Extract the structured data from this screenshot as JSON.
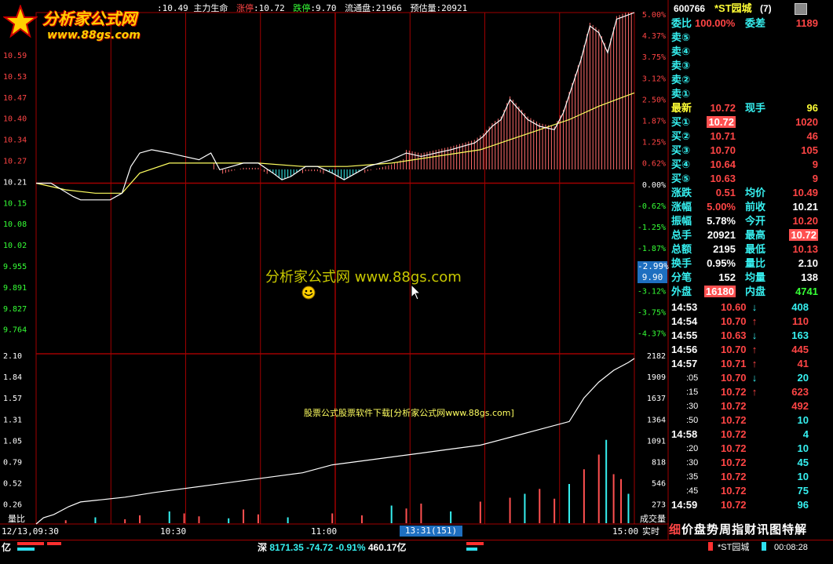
{
  "logo": {
    "title": "分析家公式网",
    "url": "www.88gs.com"
  },
  "info_bar": {
    "stock_name_partial": "*ST园城",
    "price_label": "均价",
    "price_value": ":10.49",
    "indicator": "主力生命",
    "limit_up_label": "涨停",
    "limit_up_value": ":10.72",
    "limit_down_label": "跌停",
    "limit_down_value": ":9.70",
    "float_label": "流通盘",
    "float_value": ":21966",
    "estimate_label": "预估量",
    "estimate_value": ":20921"
  },
  "watermark": {
    "main": "分析家公式网 www.88gs.com",
    "sub": "股票公式股票软件下载[分析家公式网www.88gs.com]"
  },
  "chart_data": {
    "type": "line",
    "price_axis": {
      "left_ticks": [
        "10.59",
        "10.53",
        "10.47",
        "10.40",
        "10.34",
        "10.27",
        "10.21",
        "10.15",
        "10.08",
        "10.02",
        "9.955",
        "9.891",
        "9.827",
        "9.764"
      ],
      "right_ticks": [
        "5.00%",
        "4.37%",
        "3.75%",
        "3.12%",
        "2.50%",
        "1.87%",
        "1.25%",
        "0.62%",
        "0.00%",
        "-0.62%",
        "-1.25%",
        "-1.87%",
        "-2.99%",
        "-3.12%",
        "-3.75%",
        "-4.37%"
      ],
      "cursor_pct": "-2.99%",
      "cursor_price": "9.90",
      "ylim": [
        9.7,
        10.72
      ],
      "prev_close": 10.21
    },
    "volume_axis": {
      "left_ticks": [
        "2.10",
        "1.84",
        "1.57",
        "1.31",
        "1.05",
        "0.79",
        "0.52",
        "0.26"
      ],
      "left_label": "量比",
      "right_ticks": [
        "2182",
        "1909",
        "1637",
        "1364",
        "1091",
        "818",
        "546",
        "273"
      ],
      "right_label": "成交量"
    },
    "x_axis": {
      "ticks": [
        "12/13,09:30",
        "10:30",
        "11:00",
        "15:00"
      ],
      "cursor_time": "13:31(151)",
      "realtime_label": "实时"
    },
    "price_series": [
      [
        0,
        10.21
      ],
      [
        10,
        10.21
      ],
      [
        25,
        10.17
      ],
      [
        30,
        10.16
      ],
      [
        50,
        10.16
      ],
      [
        58,
        10.18
      ],
      [
        64,
        10.26
      ],
      [
        70,
        10.3
      ],
      [
        78,
        10.31
      ],
      [
        90,
        10.3
      ],
      [
        100,
        10.29
      ],
      [
        110,
        10.28
      ],
      [
        118,
        10.3
      ],
      [
        124,
        10.25
      ],
      [
        132,
        10.26
      ],
      [
        140,
        10.27
      ],
      [
        150,
        10.27
      ],
      [
        160,
        10.24
      ],
      [
        166,
        10.22
      ],
      [
        172,
        10.23
      ],
      [
        182,
        10.26
      ],
      [
        190,
        10.26
      ],
      [
        200,
        10.24
      ],
      [
        208,
        10.22
      ],
      [
        216,
        10.24
      ],
      [
        224,
        10.26
      ],
      [
        232,
        10.27
      ],
      [
        240,
        10.28
      ],
      [
        250,
        10.3
      ],
      [
        260,
        10.29
      ],
      [
        270,
        10.3
      ],
      [
        280,
        10.31
      ],
      [
        288,
        10.32
      ],
      [
        296,
        10.33
      ],
      [
        302,
        10.35
      ],
      [
        308,
        10.38
      ],
      [
        314,
        10.4
      ],
      [
        320,
        10.46
      ],
      [
        326,
        10.43
      ],
      [
        332,
        10.4
      ],
      [
        340,
        10.38
      ],
      [
        350,
        10.37
      ],
      [
        356,
        10.42
      ],
      [
        362,
        10.5
      ],
      [
        368,
        10.58
      ],
      [
        374,
        10.68
      ],
      [
        380,
        10.66
      ],
      [
        386,
        10.6
      ],
      [
        392,
        10.7
      ],
      [
        398,
        10.71
      ],
      [
        404,
        10.72
      ]
    ],
    "avg_series": [
      [
        0,
        10.21
      ],
      [
        20,
        10.19
      ],
      [
        40,
        10.18
      ],
      [
        58,
        10.18
      ],
      [
        70,
        10.24
      ],
      [
        90,
        10.27
      ],
      [
        120,
        10.27
      ],
      [
        150,
        10.27
      ],
      [
        180,
        10.26
      ],
      [
        210,
        10.26
      ],
      [
        240,
        10.27
      ],
      [
        270,
        10.29
      ],
      [
        300,
        10.31
      ],
      [
        320,
        10.34
      ],
      [
        340,
        10.37
      ],
      [
        360,
        10.4
      ],
      [
        380,
        10.44
      ],
      [
        398,
        10.47
      ],
      [
        404,
        10.48
      ]
    ],
    "volume_ratio_series": [
      [
        0,
        0.0
      ],
      [
        5,
        0.08
      ],
      [
        12,
        0.12
      ],
      [
        22,
        0.22
      ],
      [
        30,
        0.28
      ],
      [
        40,
        0.3
      ],
      [
        60,
        0.34
      ],
      [
        80,
        0.4
      ],
      [
        100,
        0.45
      ],
      [
        120,
        0.5
      ],
      [
        140,
        0.55
      ],
      [
        160,
        0.6
      ],
      [
        180,
        0.65
      ],
      [
        200,
        0.75
      ],
      [
        220,
        0.8
      ],
      [
        240,
        0.85
      ],
      [
        260,
        0.9
      ],
      [
        280,
        0.95
      ],
      [
        300,
        1.0
      ],
      [
        320,
        1.1
      ],
      [
        340,
        1.2
      ],
      [
        360,
        1.3
      ],
      [
        370,
        1.6
      ],
      [
        380,
        1.8
      ],
      [
        390,
        1.95
      ],
      [
        400,
        2.05
      ],
      [
        404,
        2.1
      ]
    ],
    "volume_bars": [
      [
        20,
        3
      ],
      [
        40,
        6
      ],
      [
        60,
        4
      ],
      [
        70,
        8
      ],
      [
        90,
        12
      ],
      [
        100,
        10
      ],
      [
        110,
        7
      ],
      [
        130,
        5
      ],
      [
        140,
        14
      ],
      [
        150,
        9
      ],
      [
        170,
        6
      ],
      [
        200,
        10
      ],
      [
        220,
        8
      ],
      [
        240,
        18
      ],
      [
        250,
        15
      ],
      [
        260,
        20
      ],
      [
        280,
        12
      ],
      [
        300,
        22
      ],
      [
        320,
        26
      ],
      [
        330,
        30
      ],
      [
        340,
        35
      ],
      [
        350,
        25
      ],
      [
        360,
        40
      ],
      [
        370,
        55
      ],
      [
        380,
        70
      ],
      [
        385,
        85
      ],
      [
        390,
        50
      ],
      [
        395,
        45
      ],
      [
        400,
        30
      ]
    ]
  },
  "right_panel": {
    "code": "600766",
    "name": "*ST园城",
    "badge": "(7)",
    "weibi_label": "委比",
    "weibi_value": "100.00%",
    "weicha_label": "委差",
    "weicha_value": "1189",
    "sell_labels": [
      "卖⑤",
      "卖④",
      "卖③",
      "卖②",
      "卖①"
    ],
    "latest_label": "最新",
    "latest_value": "10.72",
    "now_hand_label": "现手",
    "now_hand_value": "96",
    "buy": [
      {
        "label": "买①",
        "price": "10.72",
        "vol": "1020"
      },
      {
        "label": "买②",
        "price": "10.71",
        "vol": "46"
      },
      {
        "label": "买③",
        "price": "10.70",
        "vol": "105"
      },
      {
        "label": "买④",
        "price": "10.64",
        "vol": "9"
      },
      {
        "label": "买⑤",
        "price": "10.63",
        "vol": "9"
      }
    ],
    "stats": [
      {
        "l1": "涨跌",
        "v1": "0.51",
        "l2": "均价",
        "v2": "10.49"
      },
      {
        "l1": "涨幅",
        "v1": "5.00%",
        "l2": "前收",
        "v2": "10.21"
      },
      {
        "l1": "振幅",
        "v1": "5.78%",
        "l2": "今开",
        "v2": "10.20"
      },
      {
        "l1": "总手",
        "v1": "20921",
        "l2": "最高",
        "v2": "10.72"
      },
      {
        "l1": "总额",
        "v1": "2195",
        "l2": "最低",
        "v2": "10.13"
      },
      {
        "l1": "换手",
        "v1": "0.95%",
        "l2": "量比",
        "v2": "2.10"
      },
      {
        "l1": "分笔",
        "v1": "152",
        "l2": "均量",
        "v2": "138"
      }
    ],
    "outer_label": "外盘",
    "outer_value": "16180",
    "inner_label": "内盘",
    "inner_value": "4741",
    "ticks": [
      {
        "t": "14:53",
        "sub": "",
        "p": "10.60",
        "a": "↓",
        "v": "408"
      },
      {
        "t": "14:54",
        "sub": "",
        "p": "10.70",
        "a": "↑",
        "v": "110"
      },
      {
        "t": "14:55",
        "sub": "",
        "p": "10.63",
        "a": "↓",
        "v": "163"
      },
      {
        "t": "14:56",
        "sub": "",
        "p": "10.70",
        "a": "↑",
        "v": "445"
      },
      {
        "t": "14:57",
        "sub": "",
        "p": "10.71",
        "a": "↑",
        "v": "41"
      },
      {
        "t": "",
        "sub": ":05",
        "p": "10.70",
        "a": "↓",
        "v": "20"
      },
      {
        "t": "",
        "sub": ":15",
        "p": "10.72",
        "a": "↑",
        "v": "623"
      },
      {
        "t": "",
        "sub": ":30",
        "p": "10.72",
        "a": "",
        "v": "492"
      },
      {
        "t": "",
        "sub": ":50",
        "p": "10.72",
        "a": "",
        "v": "10"
      },
      {
        "t": "14:58",
        "sub": "",
        "p": "10.72",
        "a": "",
        "v": "4"
      },
      {
        "t": "",
        "sub": ":20",
        "p": "10.72",
        "a": "",
        "v": "10"
      },
      {
        "t": "",
        "sub": ":30",
        "p": "10.72",
        "a": "",
        "v": "45"
      },
      {
        "t": "",
        "sub": ":35",
        "p": "10.72",
        "a": "",
        "v": "10"
      },
      {
        "t": "",
        "sub": ":45",
        "p": "10.72",
        "a": "",
        "v": "75"
      },
      {
        "t": "14:59",
        "sub": "",
        "p": "10.72",
        "a": "",
        "v": "96"
      }
    ],
    "tabs": [
      "细",
      "价",
      "盘",
      "势",
      "周",
      "指",
      "财",
      "讯",
      "图",
      "特",
      "解"
    ]
  },
  "status_bar": {
    "left_unit": "亿",
    "index_name": "深",
    "index_value": "8171.35",
    "index_change": "-74.72",
    "index_pct": "-0.91%",
    "index_amount": "460.17亿",
    "alert_name": "*ST园城",
    "time": "00:08:28"
  },
  "colors": {
    "grid": "#a00000",
    "price": "#ffffff",
    "avg": "#ffff00",
    "axis_red": "#ff4545",
    "axis_green": "#36ff36",
    "cyan": "#36f0f0"
  }
}
